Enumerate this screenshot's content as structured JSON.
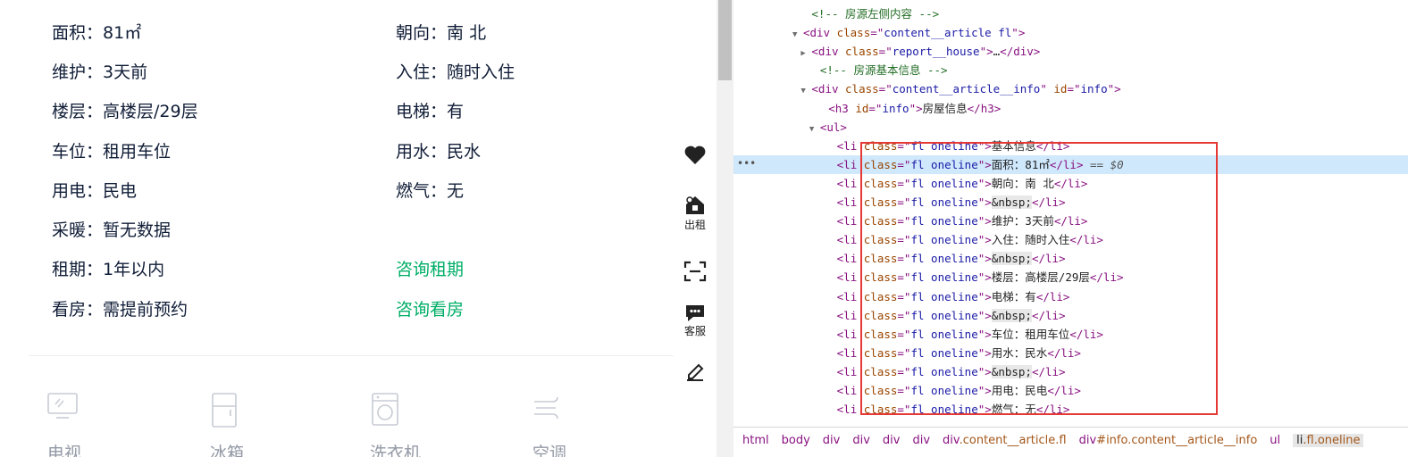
{
  "house_info": {
    "rows": [
      {
        "label": "面积",
        "value": "81㎡"
      },
      {
        "label": "朝向",
        "value": "南 北"
      },
      {
        "label": "维护",
        "value": "3天前"
      },
      {
        "label": "入住",
        "value": "随时入住"
      },
      {
        "label": "楼层",
        "value": "高楼层/29层"
      },
      {
        "label": "电梯",
        "value": "有"
      },
      {
        "label": "车位",
        "value": "租用车位"
      },
      {
        "label": "用水",
        "value": "民水"
      },
      {
        "label": "用电",
        "value": "民电"
      },
      {
        "label": "燃气",
        "value": "无"
      },
      {
        "label": "采暖",
        "value": "暂无数据"
      },
      {
        "label": "租期",
        "value": "1年以内"
      },
      {
        "label": "看房",
        "value": "需提前预约"
      }
    ],
    "consult_lease": "咨询租期",
    "consult_viewing": "咨询看房"
  },
  "facilities": [
    {
      "label": "电视",
      "icon": "tv-icon"
    },
    {
      "label": "冰箱",
      "icon": "fridge-icon"
    },
    {
      "label": "洗衣机",
      "icon": "washer-icon"
    },
    {
      "label": "空调",
      "icon": "air-conditioner-icon"
    }
  ],
  "side_bar": {
    "favorite_icon": "heart-icon",
    "rent_out_label": "出租",
    "scan_icon": "scan-icon",
    "service_label": "客服",
    "edit_icon": "edit-icon"
  },
  "devtools": {
    "lines": [
      {
        "indent": 8,
        "tri": "",
        "parts": [
          {
            "t": "<!-- 房源左侧内容 -->",
            "c": "cm"
          }
        ]
      },
      {
        "indent": 7,
        "tri": "▼",
        "parts": [
          {
            "t": "<div ",
            "c": "tg"
          },
          {
            "t": "class",
            "c": "an"
          },
          {
            "t": "=\"",
            "c": "tg"
          },
          {
            "t": "content__article fl",
            "c": "av"
          },
          {
            "t": "\">",
            "c": "tg"
          }
        ]
      },
      {
        "indent": 8,
        "tri": "▶",
        "parts": [
          {
            "t": "<div ",
            "c": "tg"
          },
          {
            "t": "class",
            "c": "an"
          },
          {
            "t": "=\"",
            "c": "tg"
          },
          {
            "t": "report__house",
            "c": "av"
          },
          {
            "t": "\">",
            "c": "tg"
          },
          {
            "t": "…",
            "c": "tx"
          },
          {
            "t": "</div>",
            "c": "tg"
          }
        ]
      },
      {
        "indent": 9,
        "tri": "",
        "parts": [
          {
            "t": "<!-- 房源基本信息 -->",
            "c": "cm"
          }
        ]
      },
      {
        "indent": 8,
        "tri": "▼",
        "parts": [
          {
            "t": "<div ",
            "c": "tg"
          },
          {
            "t": "class",
            "c": "an"
          },
          {
            "t": "=\"",
            "c": "tg"
          },
          {
            "t": "content__article__info",
            "c": "av"
          },
          {
            "t": "\" ",
            "c": "tg"
          },
          {
            "t": "id",
            "c": "an"
          },
          {
            "t": "=\"",
            "c": "tg"
          },
          {
            "t": "info",
            "c": "av"
          },
          {
            "t": "\">",
            "c": "tg"
          }
        ]
      },
      {
        "indent": 10,
        "tri": "",
        "parts": [
          {
            "t": "<h3 ",
            "c": "tg"
          },
          {
            "t": "id",
            "c": "an"
          },
          {
            "t": "=\"",
            "c": "tg"
          },
          {
            "t": "info",
            "c": "av"
          },
          {
            "t": "\">",
            "c": "tg"
          },
          {
            "t": "房屋信息",
            "c": "tx"
          },
          {
            "t": "</h3>",
            "c": "tg"
          }
        ]
      },
      {
        "indent": 9,
        "tri": "▼",
        "parts": [
          {
            "t": "<ul>",
            "c": "tg"
          }
        ]
      },
      {
        "indent": 11,
        "tri": "",
        "parts": [
          {
            "t": "<li ",
            "c": "tg"
          },
          {
            "t": "class",
            "c": "an"
          },
          {
            "t": "=\"",
            "c": "tg"
          },
          {
            "t": "fl oneline",
            "c": "av"
          },
          {
            "t": "\">",
            "c": "tg"
          },
          {
            "t": "基本信息",
            "c": "tx"
          },
          {
            "t": "</li>",
            "c": "tg"
          }
        ]
      },
      {
        "indent": 11,
        "tri": "",
        "selected": true,
        "parts": [
          {
            "t": "<li ",
            "c": "tg"
          },
          {
            "t": "class",
            "c": "an"
          },
          {
            "t": "=\"",
            "c": "tg"
          },
          {
            "t": "fl oneline",
            "c": "av"
          },
          {
            "t": "\">",
            "c": "tg"
          },
          {
            "t": "面积：81㎡",
            "c": "tx"
          },
          {
            "t": "</li>",
            "c": "tg"
          },
          {
            "t": " == ",
            "c": "eq"
          },
          {
            "t": "$0",
            "c": "dollar"
          }
        ]
      },
      {
        "indent": 11,
        "tri": "",
        "parts": [
          {
            "t": "<li ",
            "c": "tg"
          },
          {
            "t": "class",
            "c": "an"
          },
          {
            "t": "=\"",
            "c": "tg"
          },
          {
            "t": "fl oneline",
            "c": "av"
          },
          {
            "t": "\">",
            "c": "tg"
          },
          {
            "t": "朝向：南 北",
            "c": "tx"
          },
          {
            "t": "</li>",
            "c": "tg"
          }
        ]
      },
      {
        "indent": 11,
        "tri": "",
        "parts": [
          {
            "t": "<li ",
            "c": "tg"
          },
          {
            "t": "class",
            "c": "an"
          },
          {
            "t": "=\"",
            "c": "tg"
          },
          {
            "t": "fl oneline",
            "c": "av"
          },
          {
            "t": "\">",
            "c": "tg"
          },
          {
            "t": "&nbsp;",
            "c": "ent"
          },
          {
            "t": "</li>",
            "c": "tg"
          }
        ]
      },
      {
        "indent": 11,
        "tri": "",
        "parts": [
          {
            "t": "<li ",
            "c": "tg"
          },
          {
            "t": "class",
            "c": "an"
          },
          {
            "t": "=\"",
            "c": "tg"
          },
          {
            "t": "fl oneline",
            "c": "av"
          },
          {
            "t": "\">",
            "c": "tg"
          },
          {
            "t": "维护：3天前",
            "c": "tx"
          },
          {
            "t": "</li>",
            "c": "tg"
          }
        ]
      },
      {
        "indent": 11,
        "tri": "",
        "parts": [
          {
            "t": "<li ",
            "c": "tg"
          },
          {
            "t": "class",
            "c": "an"
          },
          {
            "t": "=\"",
            "c": "tg"
          },
          {
            "t": "fl oneline",
            "c": "av"
          },
          {
            "t": "\">",
            "c": "tg"
          },
          {
            "t": "入住：随时入住",
            "c": "tx"
          },
          {
            "t": "</li>",
            "c": "tg"
          }
        ]
      },
      {
        "indent": 11,
        "tri": "",
        "parts": [
          {
            "t": "<li ",
            "c": "tg"
          },
          {
            "t": "class",
            "c": "an"
          },
          {
            "t": "=\"",
            "c": "tg"
          },
          {
            "t": "fl oneline",
            "c": "av"
          },
          {
            "t": "\">",
            "c": "tg"
          },
          {
            "t": "&nbsp;",
            "c": "ent"
          },
          {
            "t": "</li>",
            "c": "tg"
          }
        ]
      },
      {
        "indent": 11,
        "tri": "",
        "parts": [
          {
            "t": "<li ",
            "c": "tg"
          },
          {
            "t": "class",
            "c": "an"
          },
          {
            "t": "=\"",
            "c": "tg"
          },
          {
            "t": "fl oneline",
            "c": "av"
          },
          {
            "t": "\">",
            "c": "tg"
          },
          {
            "t": "楼层：高楼层/29层",
            "c": "tx"
          },
          {
            "t": "</li>",
            "c": "tg"
          }
        ]
      },
      {
        "indent": 11,
        "tri": "",
        "parts": [
          {
            "t": "<li ",
            "c": "tg"
          },
          {
            "t": "class",
            "c": "an"
          },
          {
            "t": "=\"",
            "c": "tg"
          },
          {
            "t": "fl oneline",
            "c": "av"
          },
          {
            "t": "\">",
            "c": "tg"
          },
          {
            "t": "电梯：有",
            "c": "tx"
          },
          {
            "t": "</li>",
            "c": "tg"
          }
        ]
      },
      {
        "indent": 11,
        "tri": "",
        "parts": [
          {
            "t": "<li ",
            "c": "tg"
          },
          {
            "t": "class",
            "c": "an"
          },
          {
            "t": "=\"",
            "c": "tg"
          },
          {
            "t": "fl oneline",
            "c": "av"
          },
          {
            "t": "\">",
            "c": "tg"
          },
          {
            "t": "&nbsp;",
            "c": "ent"
          },
          {
            "t": "</li>",
            "c": "tg"
          }
        ]
      },
      {
        "indent": 11,
        "tri": "",
        "parts": [
          {
            "t": "<li ",
            "c": "tg"
          },
          {
            "t": "class",
            "c": "an"
          },
          {
            "t": "=\"",
            "c": "tg"
          },
          {
            "t": "fl oneline",
            "c": "av"
          },
          {
            "t": "\">",
            "c": "tg"
          },
          {
            "t": "车位：租用车位",
            "c": "tx"
          },
          {
            "t": "</li>",
            "c": "tg"
          }
        ]
      },
      {
        "indent": 11,
        "tri": "",
        "parts": [
          {
            "t": "<li ",
            "c": "tg"
          },
          {
            "t": "class",
            "c": "an"
          },
          {
            "t": "=\"",
            "c": "tg"
          },
          {
            "t": "fl oneline",
            "c": "av"
          },
          {
            "t": "\">",
            "c": "tg"
          },
          {
            "t": "用水：民水",
            "c": "tx"
          },
          {
            "t": "</li>",
            "c": "tg"
          }
        ]
      },
      {
        "indent": 11,
        "tri": "",
        "parts": [
          {
            "t": "<li ",
            "c": "tg"
          },
          {
            "t": "class",
            "c": "an"
          },
          {
            "t": "=\"",
            "c": "tg"
          },
          {
            "t": "fl oneline",
            "c": "av"
          },
          {
            "t": "\">",
            "c": "tg"
          },
          {
            "t": "&nbsp;",
            "c": "ent"
          },
          {
            "t": "</li>",
            "c": "tg"
          }
        ]
      },
      {
        "indent": 11,
        "tri": "",
        "parts": [
          {
            "t": "<li ",
            "c": "tg"
          },
          {
            "t": "class",
            "c": "an"
          },
          {
            "t": "=\"",
            "c": "tg"
          },
          {
            "t": "fl oneline",
            "c": "av"
          },
          {
            "t": "\">",
            "c": "tg"
          },
          {
            "t": "用电：民电",
            "c": "tx"
          },
          {
            "t": "</li>",
            "c": "tg"
          }
        ]
      },
      {
        "indent": 11,
        "tri": "",
        "parts": [
          {
            "t": "<li ",
            "c": "tg"
          },
          {
            "t": "class",
            "c": "an"
          },
          {
            "t": "=\"",
            "c": "tg"
          },
          {
            "t": "fl oneline",
            "c": "av"
          },
          {
            "t": "\">",
            "c": "tg"
          },
          {
            "t": "燃气：无",
            "c": "tx"
          },
          {
            "t": "</li>",
            "c": "tg"
          }
        ]
      }
    ],
    "breadcrumb": [
      {
        "tag": "html",
        "cls": ""
      },
      {
        "tag": "body",
        "cls": ""
      },
      {
        "tag": "div",
        "cls": ""
      },
      {
        "tag": "div",
        "cls": ""
      },
      {
        "tag": "div",
        "cls": ""
      },
      {
        "tag": "div",
        "cls": ""
      },
      {
        "tag": "div",
        "cls": ".content__article.fl"
      },
      {
        "tag": "div",
        "cls": "#info.content__article__info"
      },
      {
        "tag": "ul",
        "cls": ""
      },
      {
        "tag": "li",
        "cls": ".fl.oneline",
        "active": true
      }
    ]
  },
  "colors": {
    "accent_green": "#00ae66",
    "highlight_red": "#e53935",
    "selection_blue": "#cfe8fc"
  }
}
